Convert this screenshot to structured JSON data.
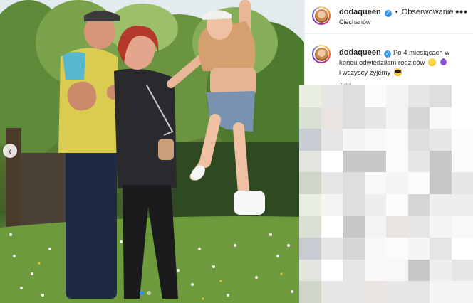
{
  "post": {
    "username": "dodaqueen",
    "separator": "•",
    "follow_label": "Obserwowanie",
    "location": "Ciechanów",
    "more_label": "•••",
    "caption": {
      "username": "dodaqueen",
      "text_line1": "Po 4 miesiącach w",
      "text_line2": "końcu odwiedziłam rodziców",
      "text_line3": "i wszyscy żyjemy"
    },
    "date": "2 dni"
  },
  "carousel": {
    "prev_label": "‹",
    "slide_count": 2,
    "active_index": 0
  },
  "icons": {
    "verified": "verified-badge-icon",
    "more": "more-options-icon",
    "carousel_prev": "chevron-left-icon"
  },
  "colors": {
    "verified": "#3897f0",
    "text": "#262626",
    "muted": "#8e8e8e",
    "dot_active": "#2f8ef5"
  }
}
